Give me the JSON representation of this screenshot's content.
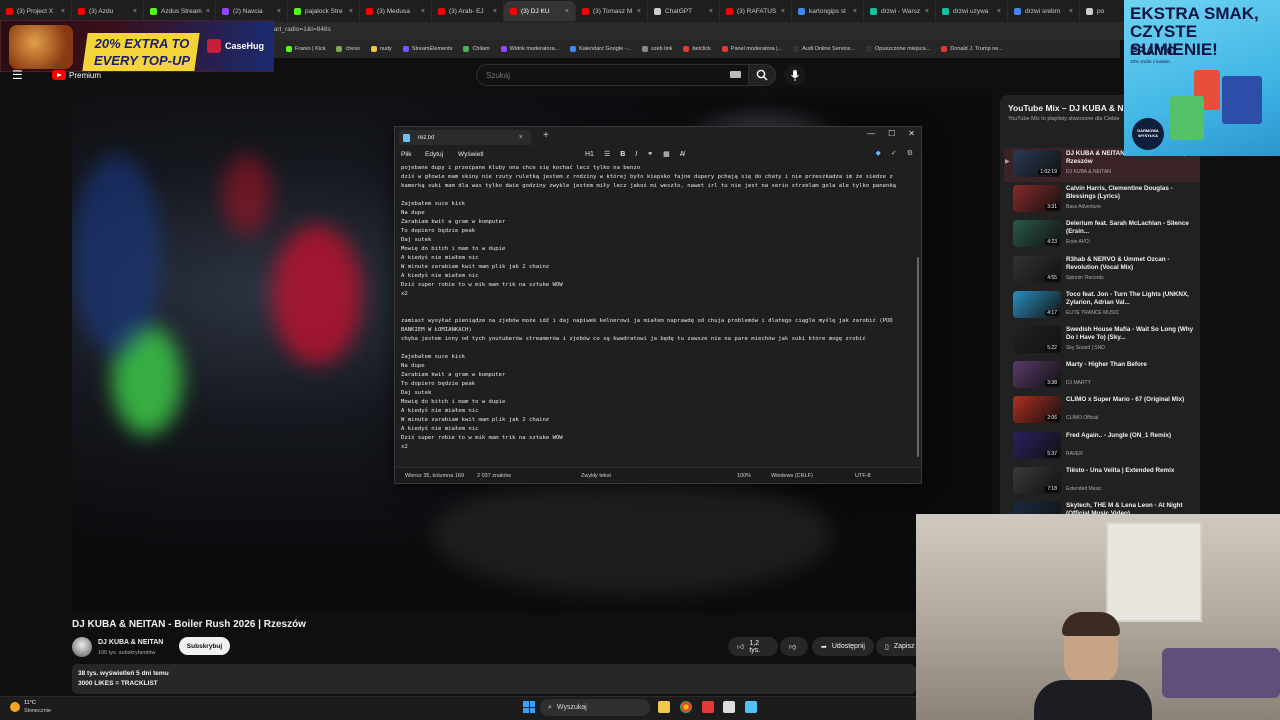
{
  "browser": {
    "tabs": [
      {
        "label": "(3) Project X",
        "color": "#ff0000"
      },
      {
        "label": "(3) Azdu",
        "color": "#ff0000"
      },
      {
        "label": "Azdus Stream",
        "color": "#53fc18"
      },
      {
        "label": "(2) Navcia",
        "color": "#9146ff"
      },
      {
        "label": "pajalock Stre",
        "color": "#53fc18"
      },
      {
        "label": "(3) Medusa",
        "color": "#ff0000"
      },
      {
        "label": "(3) Arab- EJ",
        "color": "#ff0000"
      },
      {
        "label": "(3) DJ KU",
        "color": "#ff0000",
        "active": true
      },
      {
        "label": "(3) Tomasz M",
        "color": "#ff0000"
      },
      {
        "label": "ChatGPT",
        "color": "#cccccc"
      },
      {
        "label": "(3) RAFATUS",
        "color": "#ff0000"
      },
      {
        "label": "kartongips st",
        "color": "#4285f4"
      },
      {
        "label": "drzwi - Warsz",
        "color": "#16c0a0"
      },
      {
        "label": "drzwi uzywa",
        "color": "#16c0a0"
      },
      {
        "label": "drzwi srebrn",
        "color": "#4285f4"
      },
      {
        "label": "po",
        "color": "#cccccc"
      }
    ],
    "address_fragment": "tart_radio=1&t=848s",
    "bookmarks": [
      {
        "label": "Franio | Kick",
        "color": "#53fc18"
      },
      {
        "label": "chess",
        "color": "#7fa650"
      },
      {
        "label": "nudy",
        "color": "#e8c547"
      },
      {
        "label": "StreamElements",
        "color": "#6a5cff"
      },
      {
        "label": "Chilam",
        "color": "#4caf50"
      },
      {
        "label": "Widok moderatora...",
        "color": "#9146ff"
      },
      {
        "label": "Kalendarz Google -...",
        "color": "#4285f4"
      },
      {
        "label": "szeb link",
        "color": "#888888"
      },
      {
        "label": "betclick",
        "color": "#e53935"
      },
      {
        "label": "Panel moderatora |...",
        "color": "#e53935"
      },
      {
        "label": "Audi Online Service...",
        "color": "#333333"
      },
      {
        "label": "Opuszczone miejsca...",
        "color": "#333333"
      },
      {
        "label": "Donald J. Trump ne...",
        "color": "#e53935"
      }
    ]
  },
  "ad_left": {
    "promo_text": "20% EXTRA TO EVERY TOP-UP",
    "brand": "CaseHug"
  },
  "youtube": {
    "premium_label": "Premium",
    "search_placeholder": "Szukaj"
  },
  "notepad": {
    "tab_name": "rez.txt",
    "menu": [
      "Plik",
      "Edytuj",
      "Wyświetl"
    ],
    "heading_tool": "H1",
    "text": "pojebane dupy i przećpane kluby ona chce się kochać lecz tylko na benzo\ndziś w głowie mam skiny nie rzuty ruletką jestem z rodziny w której było kiepsko fajne dupery pchają się do chaty i nie przeszkadza im że siedze z kamerką suki mam dla was tylko dwie godziny zwykle jestem miły lecz jakoś mi weszło, nawet irl tu nie jest na serio strzelam gola ale tylko panenką\n\nZajebałem suce kick\nNa dupe\nZarabiam kwit a gram w komputer\nTo dopiero będzie peak\nDaj sutek\nMowię do bitch i mam to w dupie\nA kiedyś nie miałem nic\nW minute zarabiam kwit mam plik jak 2 chainz\nA kiedyś nie miałem nic\nDziś super robie to w mik mam trik na sztuke WOW\nx2\n\n\nzamiast wysyłać pieniądze na zjebów może idź i daj napiwek kelnerowi ja miałem naprawdę od chuja problemów i dlatego ciągle myślę jak zarobić (POD BANKIEM W ŁOMIANKACH)\nchyba jestem inny od tych youtuberów streamerów i zjebów co są kwadratowi ja będę tu zawsze nie na pare miechów jak suki które mogę zrobić\n\nZajebałem suce kick\nNa dupe\nZarabiam kwit a gram w komputer\nTo dopiero będzie peak\nDaj sutek\nMowię do bitch i mam to w dupie\nA kiedyś nie miałem nic\nW minute zarabiam kwit mam plik jak 2 chainz\nA kiedyś nie miałem nic\nDziś super robie to w mik mam trik na sztuke WOW\nx2",
    "status": {
      "position": "Wiersz 35, kolumna 169",
      "chars": "2 037 znaków",
      "format": "Zwykły tekst",
      "zoom": "100%",
      "line_ending": "Windows (CRLF)",
      "encoding": "UTF-8"
    }
  },
  "video": {
    "title": "DJ KUBA & NEITAN - Boiler Rush 2026 | Rzeszów",
    "channel": "DJ KUBA & NEITAN",
    "subscribers": "100 tys. subskrybentów",
    "subscribe_label": "Subskrybuj",
    "likes": "1,2 tys.",
    "share_label": "Udostępnij",
    "save_label": "Zapisz",
    "desc_line1": "38 tys. wyświetleń  5 dni temu",
    "desc_line2": "3000 LIKES = TRACKLIST"
  },
  "mix": {
    "title": "YouTube Mix – DJ KUBA & NEITAN",
    "subtitle": "YouTube Mix to playlisty stworzone dla Ciebie",
    "items": [
      {
        "title": "DJ KUBA & NEITAN - Boiler Rush 2026 | Rzeszów",
        "channel": "DJ KUBA & NEITAN",
        "duration": "1:02:19",
        "thumb": "#2a3a55",
        "active": true
      },
      {
        "title": "Calvin Harris, Clementine Douglas - Blessings (Lyrics)",
        "channel": "Bass Adventure",
        "duration": "3:31",
        "thumb": "#8a2a2a"
      },
      {
        "title": "Delerium feat. Sarah McLachlan - Silence (Ersin...",
        "channel": "Ersin AVCI",
        "duration": "4:23",
        "thumb": "#2a5a4a"
      },
      {
        "title": "R3hab & NERVO & Ummet Ozcan - Revolution (Vocal Mix)",
        "channel": "Spinnin' Records",
        "duration": "4:55",
        "thumb": "#333333"
      },
      {
        "title": "Toco feat. Jon - Turn The Lights (UNKNX, Zylarion, Adrian Val...",
        "channel": "ELITE TRANCE MUSIC",
        "duration": "4:17",
        "thumb": "#2a8fc0"
      },
      {
        "title": "Swedish House Mafia - Wait So Long (Why Do I Have To) (Sky...",
        "channel": "Sky Sound | SND",
        "duration": "5:22",
        "thumb": "#222222"
      },
      {
        "title": "Marty - Higher Than Before",
        "channel": "DJ MARTY",
        "duration": "3:38",
        "thumb": "#5a3a6a"
      },
      {
        "title": "CLIMO x Super Mario - 67 (Original Mix)",
        "channel": "CLIMO Official",
        "duration": "2:06",
        "thumb": "#b03020"
      },
      {
        "title": "Fred Again.. - Jungle (ON_1 Remix)",
        "channel": "RAVER",
        "duration": "5:37",
        "thumb": "#2a2060"
      },
      {
        "title": "Tiësto - Una Velita | Extended Remix",
        "channel": "Extended Music",
        "duration": "7:18",
        "thumb": "#3a3a3a"
      },
      {
        "title": "Skytech, THE M & Lena Leon - At Night (Official Music Video)",
        "channel": "",
        "duration": "",
        "thumb": "#1a2a40"
      }
    ]
  },
  "ad_right": {
    "line1": "EKSTRA SMAK, CZYSTE SUMIENIE!",
    "brand": "FRANIO",
    "small": "10% zniżki z kodem",
    "badge": "DARMOWA WYSYŁKA"
  },
  "taskbar": {
    "temp": "11°C",
    "condition": "Słonecznie",
    "search_label": "Wyszukaj"
  }
}
